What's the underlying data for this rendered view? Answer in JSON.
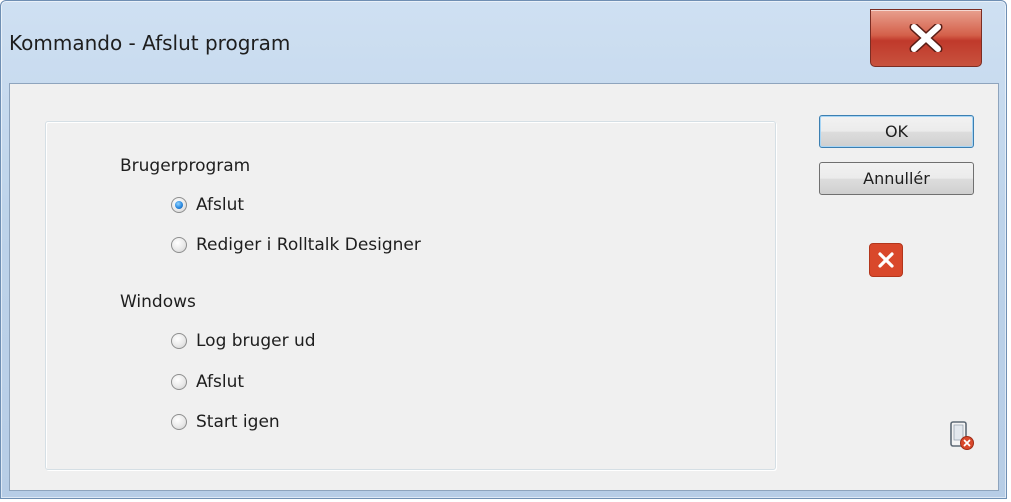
{
  "window": {
    "title": "Kommando - Afslut program"
  },
  "groups": {
    "brugerprogram": {
      "label": "Brugerprogram",
      "options": [
        {
          "label": "Afslut",
          "checked": true
        },
        {
          "label": "Rediger i Rolltalk Designer",
          "checked": false
        }
      ]
    },
    "windows": {
      "label": "Windows",
      "options": [
        {
          "label": "Log bruger ud",
          "checked": false
        },
        {
          "label": "Afslut",
          "checked": false
        },
        {
          "label": "Start igen",
          "checked": false
        }
      ]
    }
  },
  "buttons": {
    "ok": "OK",
    "cancel": "Annullér"
  },
  "icons": {
    "title_close": "close-icon",
    "delete": "delete-icon",
    "device_remove": "device-remove-icon"
  },
  "colors": {
    "close_button": "#c8523e",
    "delete_button": "#d9482b",
    "radio_selected": "#2b8ae0"
  }
}
